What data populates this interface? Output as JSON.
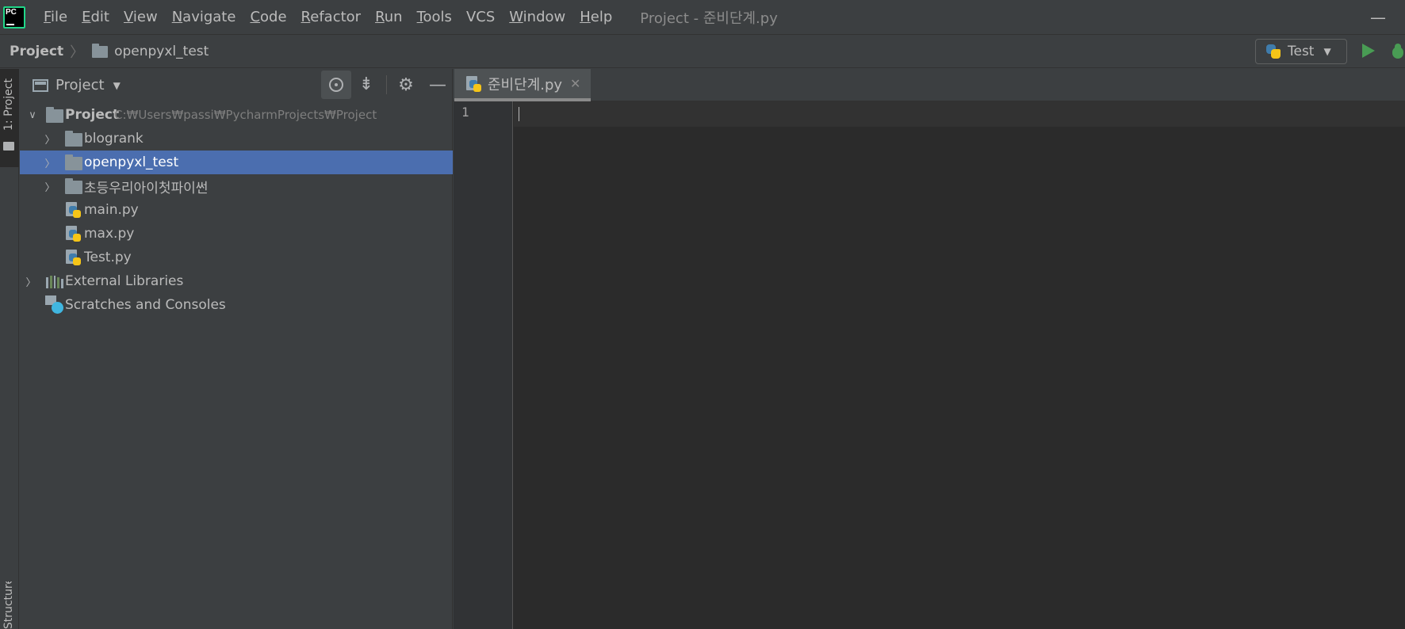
{
  "menubar": {
    "logo": "PC",
    "items": [
      {
        "label": "File",
        "mnemonic": "F",
        "rest": "ile"
      },
      {
        "label": "Edit",
        "mnemonic": "E",
        "rest": "dit"
      },
      {
        "label": "View",
        "mnemonic": "V",
        "rest": "iew"
      },
      {
        "label": "Navigate",
        "mnemonic": "N",
        "rest": "avigate"
      },
      {
        "label": "Code",
        "mnemonic": "C",
        "rest": "ode"
      },
      {
        "label": "Refactor",
        "mnemonic": "R",
        "rest": "efactor"
      },
      {
        "label": "Run",
        "mnemonic": "R",
        "rest": "un"
      },
      {
        "label": "Tools",
        "mnemonic": "T",
        "rest": "ools"
      },
      {
        "label": "VCS",
        "mnemonic": "",
        "rest": "VCS"
      },
      {
        "label": "Window",
        "mnemonic": "W",
        "rest": "indow"
      },
      {
        "label": "Help",
        "mnemonic": "H",
        "rest": "elp"
      }
    ],
    "window_title": "Project - 준비단계.py",
    "minimize_glyph": "—"
  },
  "navbar": {
    "root": "Project",
    "separator": "〉",
    "leaf": "openpyxl_test",
    "run_config": "Test",
    "run_config_caret": "▼"
  },
  "left_strip": {
    "project_tab": "1: Project",
    "structure_tab": "Structure"
  },
  "project_panel": {
    "title": "Project",
    "caret": "▼",
    "collapse_glyph": "⇟",
    "gear_glyph": "⚙",
    "hide_glyph": "—",
    "tree": {
      "root_label": "Project",
      "root_path": "C:₩Users₩passi₩PycharmProjects₩Project",
      "items": [
        {
          "label": "blogrank"
        },
        {
          "label": "openpyxl_test"
        },
        {
          "label": "초등우리아이첫파이썬"
        },
        {
          "label": "main.py"
        },
        {
          "label": "max.py"
        },
        {
          "label": "Test.py"
        },
        {
          "label": "External Libraries"
        },
        {
          "label": "Scratches and Consoles"
        }
      ]
    },
    "chevron_collapsed": "〉",
    "chevron_expanded": "∨"
  },
  "editor": {
    "tab_label": "준비단계.py",
    "tab_close": "✕",
    "line_numbers": [
      "1"
    ]
  }
}
